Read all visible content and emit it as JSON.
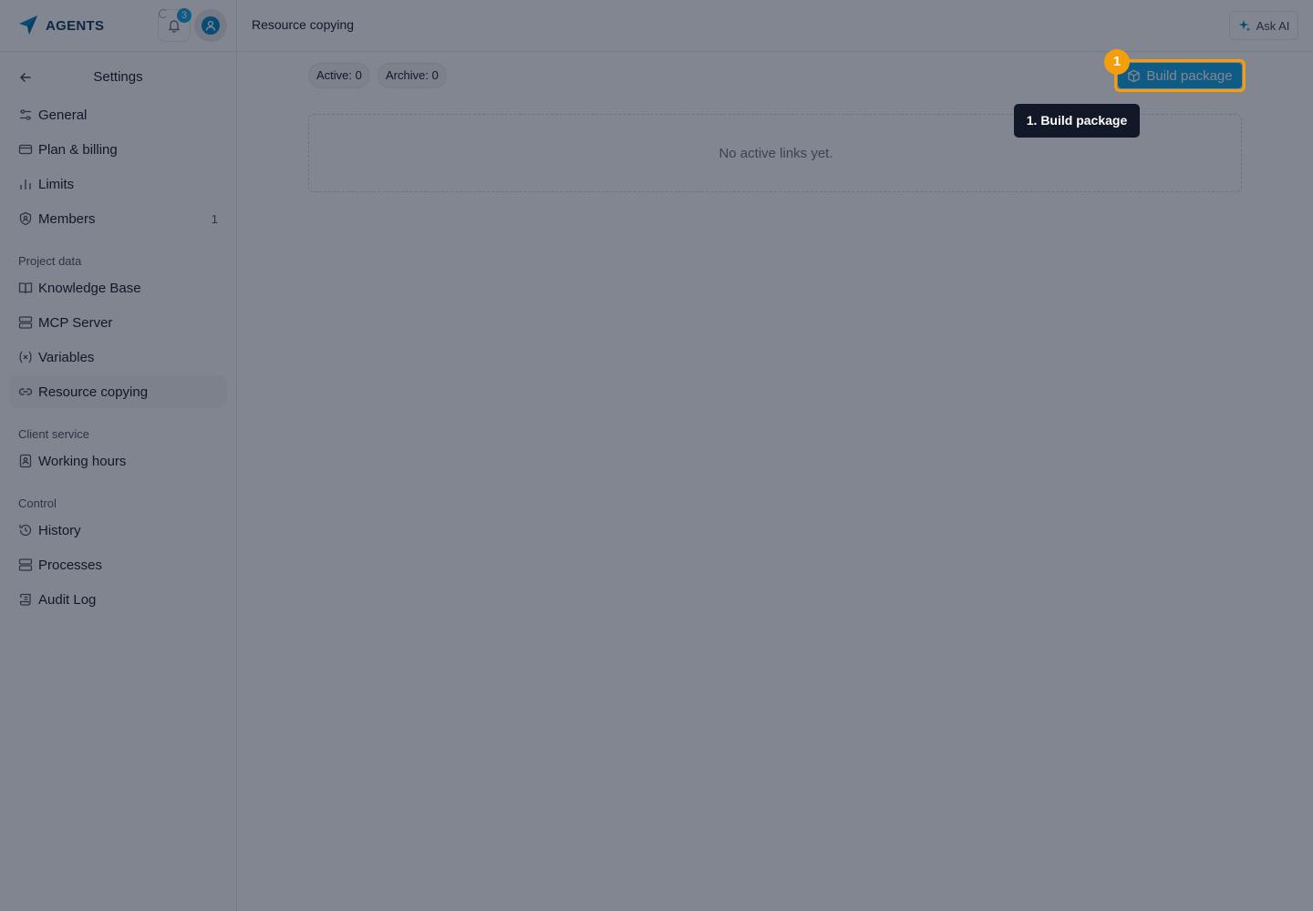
{
  "header": {
    "brand": "AGENTS",
    "notification_count": "3",
    "page_title": "Resource copying",
    "ask_ai_label": "Ask AI"
  },
  "sidebar": {
    "title": "Settings",
    "items": [
      {
        "label": "General",
        "icon": "sliders-icon"
      },
      {
        "label": "Plan & billing",
        "icon": "credit-card-icon"
      },
      {
        "label": "Limits",
        "icon": "bar-chart-icon"
      },
      {
        "label": "Members",
        "icon": "shield-user-icon",
        "count": "1"
      }
    ],
    "sections": [
      {
        "label": "Project data",
        "items": [
          {
            "label": "Knowledge Base",
            "icon": "book-open-icon"
          },
          {
            "label": "MCP Server",
            "icon": "server-icon"
          },
          {
            "label": "Variables",
            "icon": "variable-icon"
          },
          {
            "label": "Resource copying",
            "icon": "link-icon",
            "active": true
          }
        ]
      },
      {
        "label": "Client service",
        "items": [
          {
            "label": "Working hours",
            "icon": "contact-book-icon"
          }
        ]
      },
      {
        "label": "Control",
        "items": [
          {
            "label": "History",
            "icon": "history-icon"
          },
          {
            "label": "Processes",
            "icon": "server-icon"
          },
          {
            "label": "Audit Log",
            "icon": "scroll-icon"
          }
        ]
      }
    ]
  },
  "main": {
    "active_chip": "Active: 0",
    "archive_chip": "Archive: 0",
    "build_button": "Build package",
    "empty_text": "No active links yet."
  },
  "tour": {
    "step_number": "1",
    "tooltip": "1. Build package"
  },
  "colors": {
    "accent": "#0ea5e9",
    "brand": "#0284c7",
    "highlight": "#f59e0b",
    "overlay": "rgba(15,23,42,0.52)"
  }
}
